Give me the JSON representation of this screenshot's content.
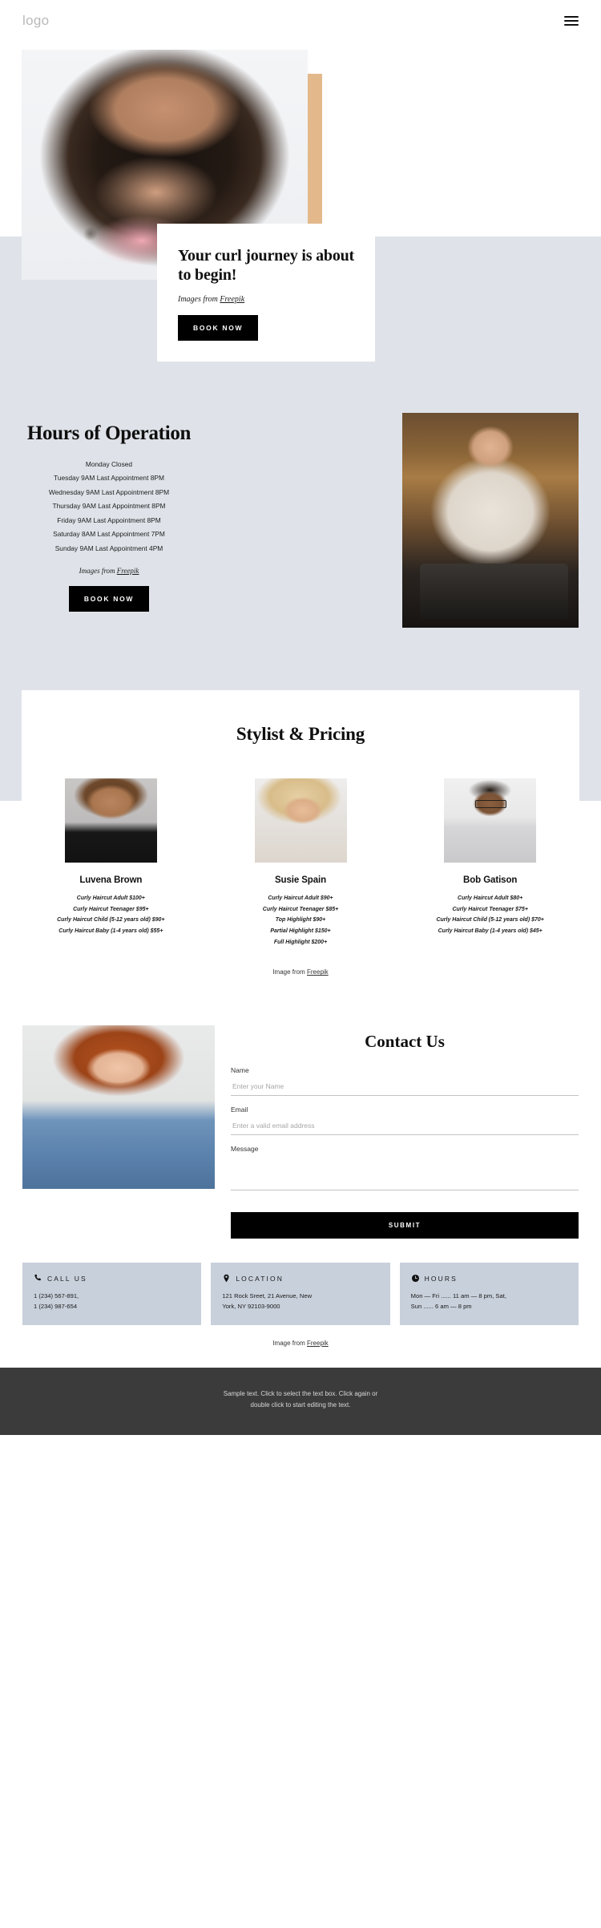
{
  "header": {
    "logo": "logo",
    "menu_label": "menu"
  },
  "hero": {
    "title": "Your curl journey is about to begin!",
    "credit_prefix": "Images from ",
    "credit_link": "Freepik",
    "cta": "BOOK NOW"
  },
  "hours": {
    "title": "Hours of Operation",
    "items": [
      "Monday Closed",
      "Tuesday 9AM Last Appointment 8PM",
      "Wednesday 9AM Last Appointment 8PM",
      "Thursday 9AM Last Appointment 8PM",
      "Friday 9AM Last Appointment 8PM",
      "Saturday 8AM Last Appointment 7PM",
      "Sunday 9AM Last Appointment 4PM"
    ],
    "credit_prefix": "Images from ",
    "credit_link": "Freepik",
    "cta": "BOOK NOW"
  },
  "stylists": {
    "title": "Stylist & Pricing",
    "cards": [
      {
        "name": "Luvena Brown",
        "prices": [
          "Curly Haircut Adult $100+",
          "Curly Haircut Teenager $95+",
          "Curly Haircut Child (5-12 years old) $90+",
          "Curly Haircut Baby (1-4 years old) $55+"
        ]
      },
      {
        "name": "Susie Spain",
        "prices": [
          "Curly Haircut Adult $90+",
          "Curly Haircut Teenager $85+",
          "Top Highlight $90+",
          "Partial Highlight $150+",
          "Full Highlight $200+"
        ]
      },
      {
        "name": "Bob Gatison",
        "prices": [
          "Curly Haircut Adult $80+",
          "Curly Haircut Teenager $75+",
          "Curly Haircut Child (5-12 years old) $70+",
          "Curly Haircut Baby (1-4 years old) $45+"
        ]
      }
    ],
    "credit_prefix": "Image from ",
    "credit_link": "Freepik"
  },
  "contact": {
    "title": "Contact Us",
    "name_label": "Name",
    "name_placeholder": "Enter your Name",
    "email_label": "Email",
    "email_placeholder": "Enter a valid email address",
    "message_label": "Message",
    "message_placeholder": "",
    "submit": "SUBMIT"
  },
  "info": [
    {
      "icon": "phone-icon",
      "title": "CALL US",
      "line1": "1 (234) 567-891,",
      "line2": "1 (234) 987-654"
    },
    {
      "icon": "location-pin-icon",
      "title": "LOCATION",
      "line1": "121 Rock Sreet, 21 Avenue, New",
      "line2": "York, NY 92103-9000"
    },
    {
      "icon": "clock-icon",
      "title": "HOURS",
      "line1": "Mon — Fri ...... 11 am — 8 pm, Sat,",
      "line2": "Sun ...... 6 am — 8 pm"
    }
  ],
  "bottom_credit": {
    "prefix": "Image from ",
    "link": "Freepik"
  },
  "footer": {
    "line1": "Sample text. Click to select the text box. Click again or",
    "line2": "double click to start editing the text."
  },
  "colors": {
    "band": "#dfe3e9",
    "tan": "#e3b98c",
    "dark": "#000000",
    "info_card": "#c8d0db",
    "footer": "#3b3b3b"
  }
}
